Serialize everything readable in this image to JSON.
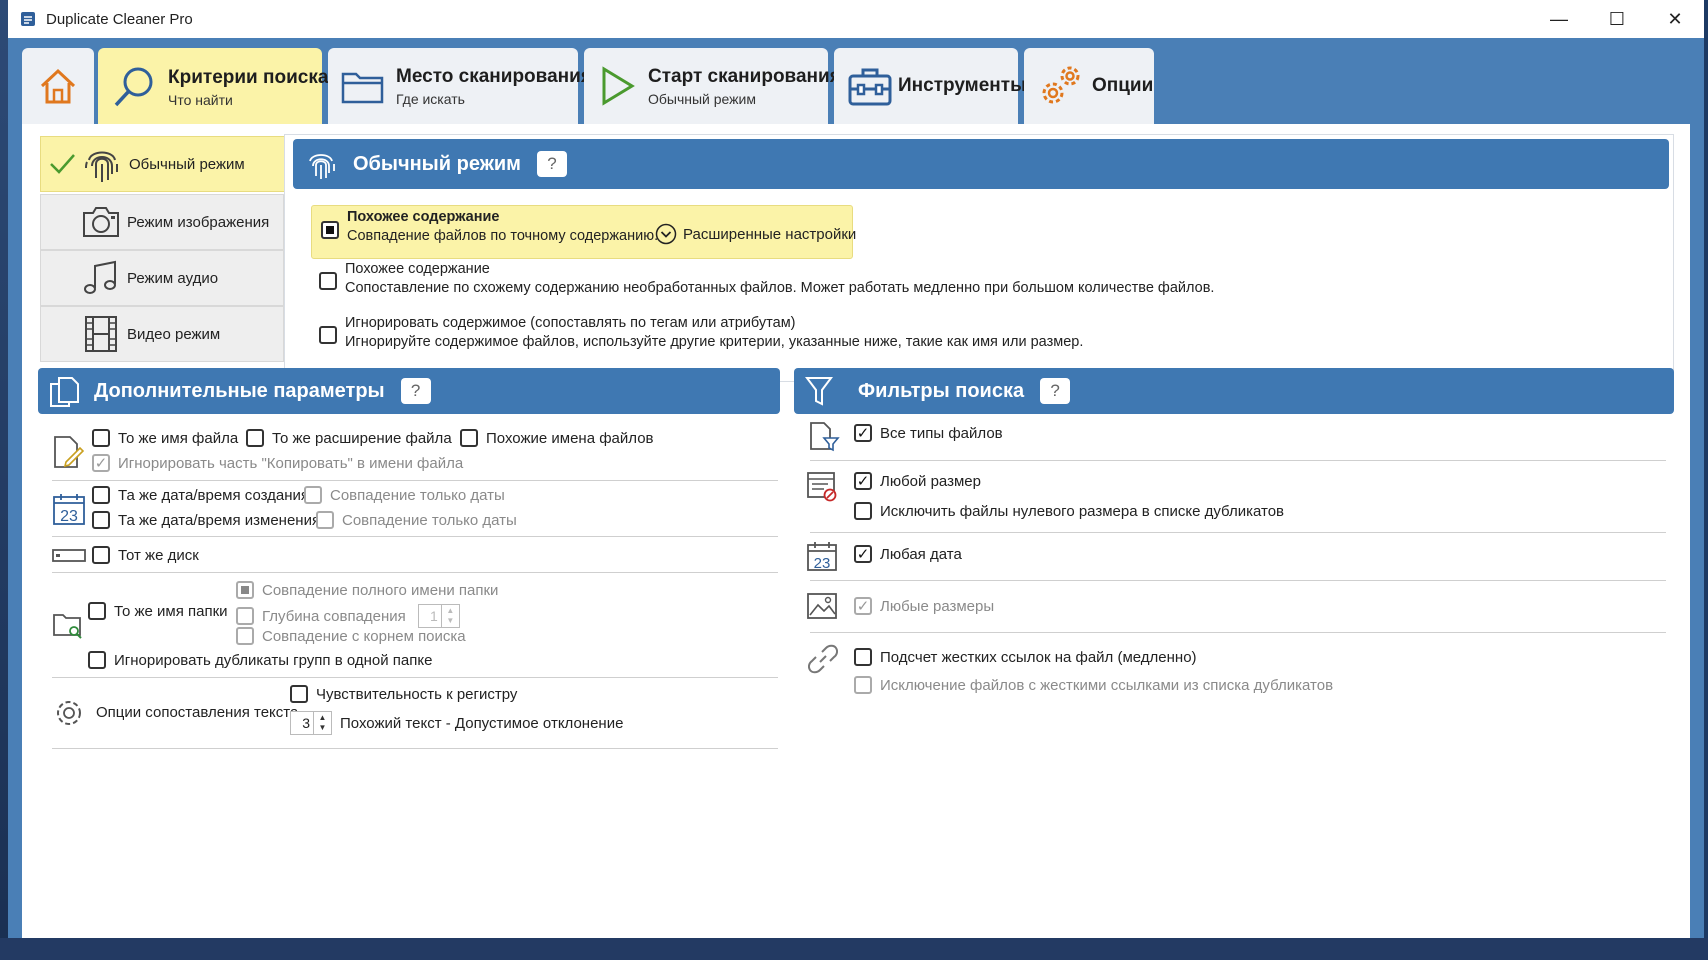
{
  "window": {
    "title": "Duplicate Cleaner Pro",
    "minimize": "—",
    "maximize": "☐",
    "close": "✕"
  },
  "tabs": [
    {
      "id": "home",
      "label": "",
      "sub": ""
    },
    {
      "id": "criteria",
      "label": "Критерии поиска",
      "sub": "Что найти"
    },
    {
      "id": "location",
      "label": "Место сканирования",
      "sub": "Где искать"
    },
    {
      "id": "start",
      "label": "Старт сканирования",
      "sub": "Обычный режим"
    },
    {
      "id": "tools",
      "label": "Инструменты",
      "sub": ""
    },
    {
      "id": "options",
      "label": "Опции",
      "sub": ""
    }
  ],
  "modes": [
    {
      "label": "Обычный режим"
    },
    {
      "label": "Режим изображения"
    },
    {
      "label": "Режим аудио"
    },
    {
      "label": "Видео режим"
    }
  ],
  "mode_panel": {
    "title": "Обычный режим",
    "help": "?",
    "options": [
      {
        "title": "Похожее содержание",
        "desc": "Совпадение файлов по точному содержанию.",
        "state": "selected"
      },
      {
        "title": "Похожее содержание",
        "desc": "Сопоставление по схожему содержанию необработанных файлов. Может работать медленно при большом количестве файлов.",
        "state": "off"
      },
      {
        "title": "Игнорировать содержимое (сопоставлять по тегам или атрибутам)",
        "desc": "Игнорируйте содержимое файлов, используйте другие критерии, указанные ниже, такие как имя или размер.",
        "state": "off"
      }
    ],
    "advanced": "Расширенные настройки"
  },
  "additional": {
    "title": "Дополнительные параметры",
    "help": "?",
    "same_name": "То же имя файла",
    "same_ext": "То же расширение файла",
    "similar_names": "Похожие имена файлов",
    "ignore_copy": "Игнорировать часть \"Копировать\" в имени файла",
    "same_created": "Та же дата/время создания",
    "created_date_only": "Совпадение только даты",
    "same_modified": "Та же дата/время изменения",
    "modified_date_only": "Совпадение только даты",
    "same_disk": "Тот же диск",
    "same_folder": "То же имя папки",
    "full_folder": "Совпадение полного имени папки",
    "depth": "Глубина совпадения",
    "depth_value": "1",
    "root_match": "Совпадение с корнем поиска",
    "ignore_same_folder": "Игнорировать дубликаты групп в одной папке",
    "text_options": "Опции сопоставления текста",
    "case_sensitive": "Чувствительность к регистру",
    "tolerance_value": "3",
    "tolerance": "Похожий текст - Допустимое отклонение",
    "calendar_day": "23"
  },
  "filters": {
    "title": "Фильтры поиска",
    "help": "?",
    "all_types": "Все типы файлов",
    "any_size": "Любой размер",
    "exclude_zero": "Исключить файлы нулевого размера в списке дубликатов",
    "any_date": "Любая дата",
    "calendar_day": "23",
    "any_dimensions": "Любые размеры",
    "hardlinks": "Подсчет жестких ссылок на файл (медленно)",
    "exclude_hardlinks": "Исключение файлов с жесткими ссылками из списка дубликатов"
  },
  "colors": {
    "accent": "#3f78b2",
    "active_tab": "#fbf3a8",
    "window_bg": "#4a7fb6"
  }
}
